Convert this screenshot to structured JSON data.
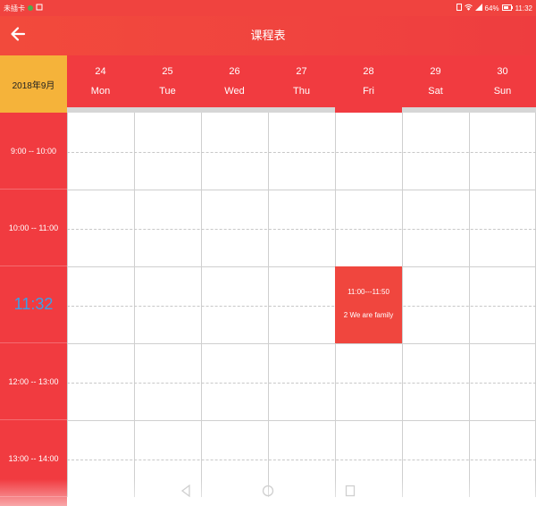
{
  "status_bar": {
    "carrier": "未插卡",
    "battery": "64%",
    "time": "11:32"
  },
  "app_bar": {
    "title": "课程表",
    "back_icon": "arrow-left-icon"
  },
  "week_header": {
    "month_label": "2018年9月",
    "days": [
      {
        "num": "24",
        "name": "Mon"
      },
      {
        "num": "25",
        "name": "Tue"
      },
      {
        "num": "26",
        "name": "Wed"
      },
      {
        "num": "27",
        "name": "Thu"
      },
      {
        "num": "28",
        "name": "Fri"
      },
      {
        "num": "29",
        "name": "Sat"
      },
      {
        "num": "30",
        "name": "Sun"
      }
    ],
    "today_index": 4
  },
  "time_slots": [
    {
      "label": "9:00 -- 10:00"
    },
    {
      "label": "10:00 -- 11:00"
    },
    {
      "label": "11:32"
    },
    {
      "label": "12:00 -- 13:00"
    },
    {
      "label": "13:00 -- 14:00"
    }
  ],
  "course": {
    "time": "11:00---11:50",
    "name": "2 We are family",
    "day": "Fri"
  },
  "colors": {
    "primary": "#f13b40",
    "month_cell": "#f5b33a",
    "current_time_text": "#3aa0e8"
  }
}
